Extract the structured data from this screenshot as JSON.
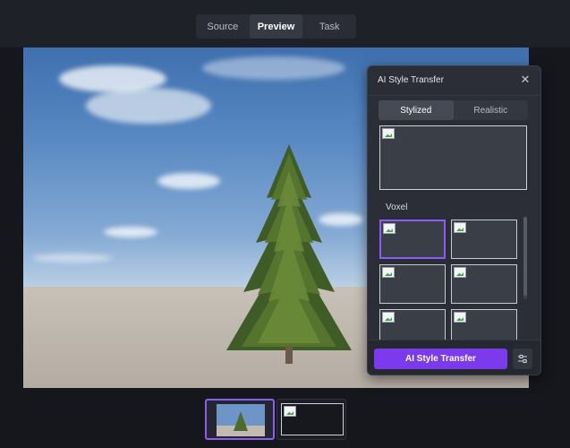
{
  "tabs": [
    {
      "label": "Source",
      "active": false
    },
    {
      "label": "Preview",
      "active": true
    },
    {
      "label": "Task",
      "active": false
    }
  ],
  "panel": {
    "title": "AI Style Transfer",
    "close_icon": "close-icon",
    "modes": [
      {
        "label": "Stylized",
        "active": true
      },
      {
        "label": "Realistic",
        "active": false
      }
    ],
    "section_label": "Voxel",
    "thumbnails_count": 6,
    "selected_thumbnail": 1,
    "primary_button": "AI Style Transfer",
    "settings_icon": "sliders-icon",
    "accent_color": "#7c3aed"
  },
  "filmstrip": {
    "items": [
      {
        "name": "tree-scene",
        "active": true
      },
      {
        "name": "blank",
        "active": false
      }
    ]
  }
}
